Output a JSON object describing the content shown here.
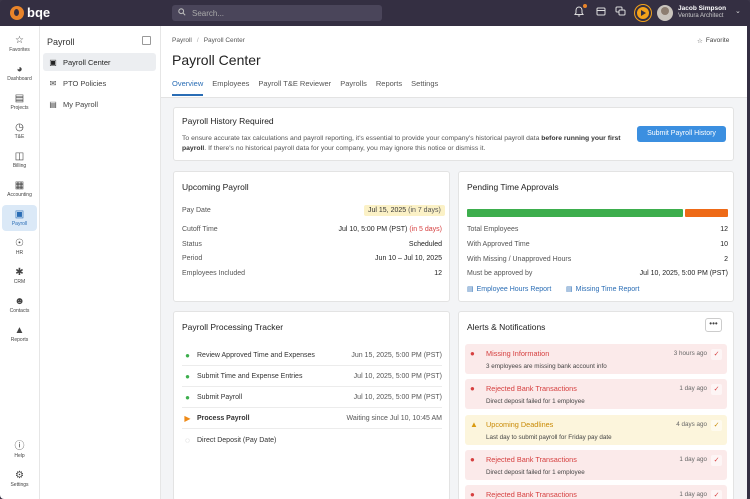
{
  "brand": {
    "name": "bqe"
  },
  "search": {
    "placeholder": "Search..."
  },
  "user": {
    "name": "Jacob Simpson",
    "role": "Ventura Architect"
  },
  "rail": [
    {
      "label": "Favorites",
      "icon": "star-icon"
    },
    {
      "label": "Dashboard",
      "icon": "dashboard-icon"
    },
    {
      "label": "Projects",
      "icon": "projects-icon"
    },
    {
      "label": "T&E",
      "icon": "clock-icon"
    },
    {
      "label": "Billing",
      "icon": "billing-icon"
    },
    {
      "label": "Accounting",
      "icon": "accounting-icon"
    },
    {
      "label": "Payroll",
      "icon": "payroll-icon"
    },
    {
      "label": "HR",
      "icon": "hr-icon"
    },
    {
      "label": "CRM",
      "icon": "crm-icon"
    },
    {
      "label": "Contacts",
      "icon": "contacts-icon"
    },
    {
      "label": "Reports",
      "icon": "reports-icon"
    },
    {
      "label": "Help",
      "icon": "help-icon"
    },
    {
      "label": "Settings",
      "icon": "settings-icon"
    }
  ],
  "subnav": {
    "title": "Payroll",
    "items": [
      {
        "label": "Payroll Center"
      },
      {
        "label": "PTO Policies"
      },
      {
        "label": "My Payroll"
      }
    ]
  },
  "breadcrumb": [
    "Payroll",
    "Payroll Center"
  ],
  "page": {
    "title": "Payroll Center",
    "favorite": "Favorite"
  },
  "tabs": [
    "Overview",
    "Employees",
    "Payroll T&E Reviewer",
    "Payrolls",
    "Reports",
    "Settings"
  ],
  "history": {
    "title": "Payroll History Required",
    "text_a": "To ensure accurate tax calculations and payroll reporting, it's essential to provide your company's historical payroll data ",
    "text_bold": "before running your first payroll",
    "text_b": ". If there's no historical payroll data for your company, you may ignore this notice or dismiss it.",
    "button": "Submit Payroll History"
  },
  "upcoming": {
    "title": "Upcoming Payroll",
    "pay_date_label": "Pay Date",
    "pay_date": "Jul 15, 2025",
    "pay_date_note": "(in 7 days)",
    "cutoff_label": "Cutoff Time",
    "cutoff": "Jul 10, 5:00 PM (PST)",
    "cutoff_note": "(in 5 days)",
    "status_label": "Status",
    "status": "Scheduled",
    "period_label": "Period",
    "period": "Jun 10 – Jul 10, 2025",
    "employees_label": "Employees Included",
    "employees": "12"
  },
  "pending": {
    "title": "Pending Time Approvals",
    "approved_fraction": 0.8333,
    "colors": {
      "approved": "#3dae4d",
      "missing": "#ee6a17"
    },
    "rows": [
      {
        "label": "Total Employees",
        "value": "12"
      },
      {
        "label": "With Approved Time",
        "value": "10"
      },
      {
        "label": "With Missing / Unapproved Hours",
        "value": "2"
      },
      {
        "label": "Must be approved by",
        "value": "Jul 10, 2025, 5:00 PM (PST)"
      }
    ],
    "link1": "Employee Hours Report",
    "link2": "Missing Time Report"
  },
  "tracker": {
    "title": "Payroll Processing Tracker",
    "steps": [
      {
        "label": "Review Approved Time and Expenses",
        "status": "Jun 15, 2025, 5:00 PM (PST)",
        "state": "done"
      },
      {
        "label": "Submit Time and Expense Entries",
        "status": "Jul 10, 2025, 5:00 PM (PST)",
        "state": "done"
      },
      {
        "label": "Submit Payroll",
        "status": "Jul 10, 2025, 5:00 PM (PST)",
        "state": "done"
      },
      {
        "label": "Process Payroll",
        "status": "Waiting since Jul 10, 10:45 AM",
        "state": "current"
      },
      {
        "label": "Direct Deposit (Pay Date)",
        "status": "",
        "state": "pending"
      }
    ]
  },
  "alerts": {
    "title": "Alerts & Notifications",
    "more": "•••",
    "items": [
      {
        "title": "Missing Information",
        "desc": "3 employees are missing bank account info",
        "time": "3 hours ago",
        "level": "error"
      },
      {
        "title": "Rejected Bank Transactions",
        "desc": "Direct deposit failed for 1 employee",
        "time": "1 day ago",
        "level": "error"
      },
      {
        "title": "Upcoming Deadlines",
        "desc": "Last day to submit payroll for Friday pay date",
        "time": "4 days ago",
        "level": "warning"
      },
      {
        "title": "Rejected Bank Transactions",
        "desc": "Direct deposit failed for 1 employee",
        "time": "1 day ago",
        "level": "error"
      },
      {
        "title": "Rejected Bank Transactions",
        "desc": "",
        "time": "1 day ago",
        "level": "error"
      }
    ]
  }
}
